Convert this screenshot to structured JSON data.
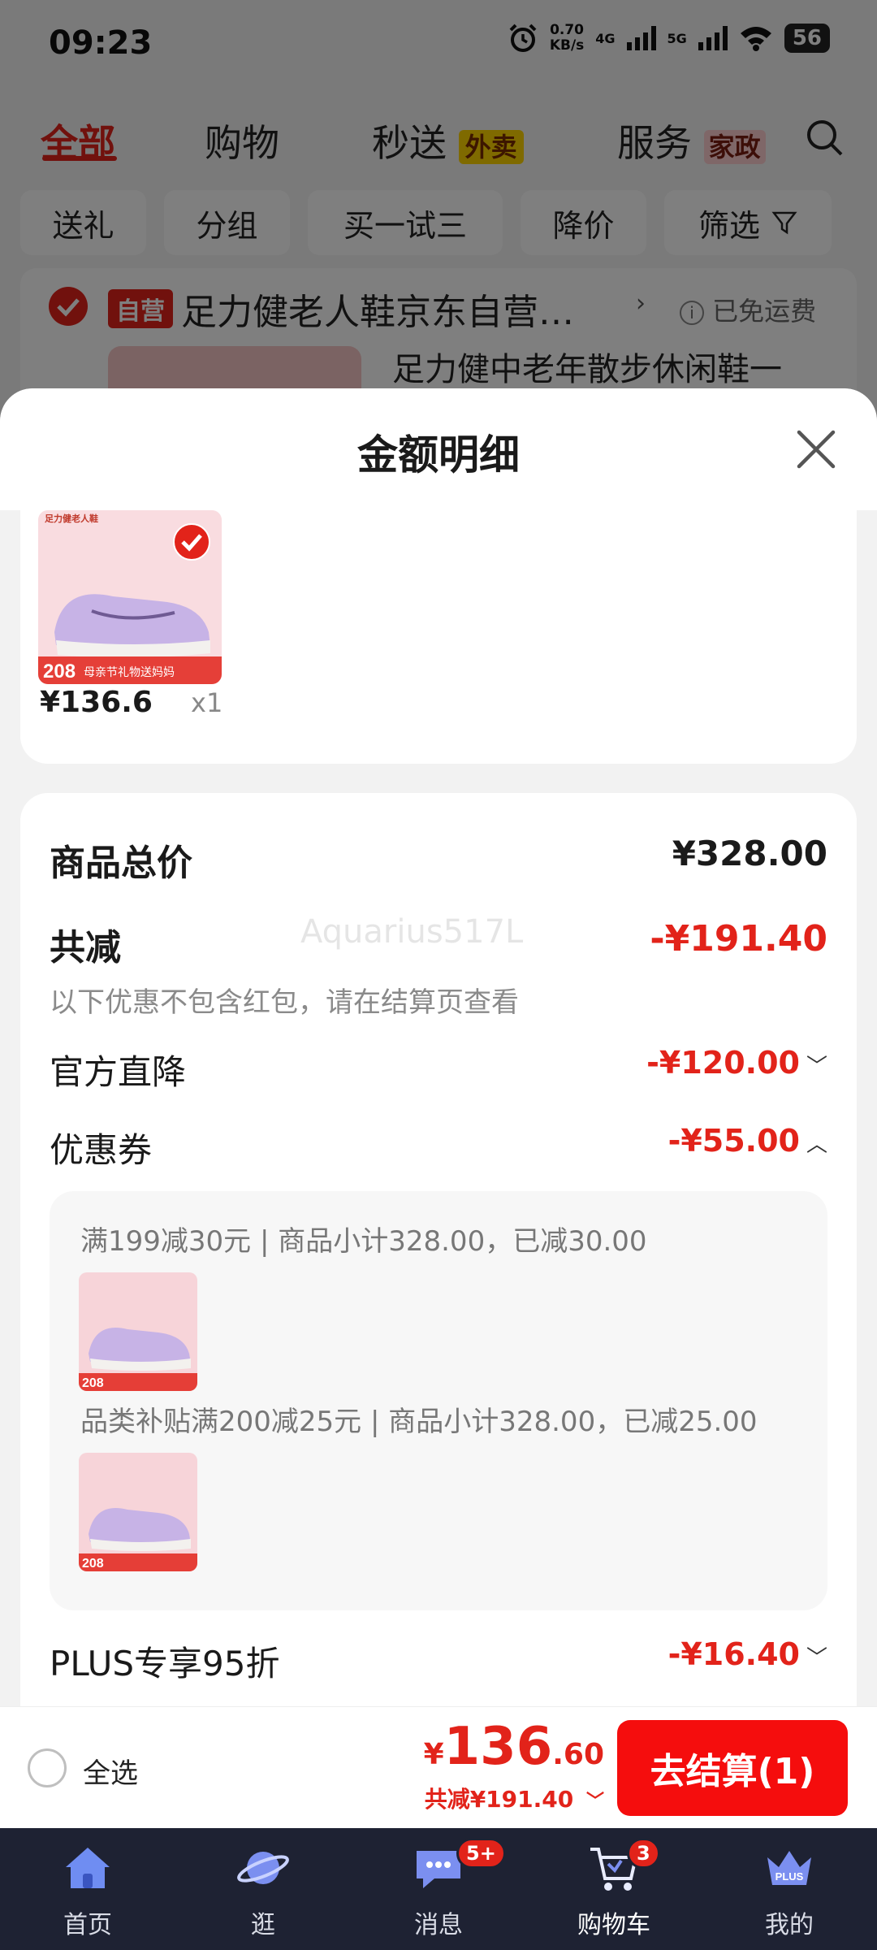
{
  "status_bar": {
    "time": "09:23",
    "net_speed": "0.70",
    "net_unit": "KB/s",
    "net_4g": "4G",
    "net_5g": "5G",
    "battery": "56"
  },
  "top_tabs": {
    "all": "全部",
    "shopping": "购物",
    "instant": "秒送",
    "instant_badge": "外卖",
    "service": "服务",
    "service_badge": "家政"
  },
  "filter_chips": {
    "gift": "送礼",
    "group": "分组",
    "try": "买一试三",
    "price_drop": "降价",
    "filter": "筛选"
  },
  "store": {
    "badge": "自营",
    "name": "足力健老人鞋京东自营…",
    "shipping": "已免运费",
    "product_title": "足力健中老年散步休闲鞋一"
  },
  "sheet": {
    "title": "金额明细",
    "item": {
      "price": "¥136.6",
      "qty": "x1",
      "brand": "足力健老人鞋",
      "promo_num": "208",
      "promo_text": "母亲节礼物送妈妈"
    }
  },
  "detail": {
    "total_label": "商品总价",
    "total_value": "¥328.00",
    "reduce_label": "共减",
    "reduce_value": "-¥191.40",
    "note": "以下优惠不包含红包，请在结算页查看",
    "official_label": "官方直降",
    "official_value": "-¥120.00",
    "coupon_label": "优惠券",
    "coupon_value": "-¥55.00",
    "coupon_line1": "满199减30元 | 商品小计328.00，已减30.00",
    "coupon_line2": "品类补贴满200减25元 | 商品小计328.00，已减25.00",
    "plus_label": "PLUS专享95折",
    "plus_value": "-¥16.40",
    "watermark": "Aquarius517L"
  },
  "checkout": {
    "select_all": "全选",
    "currency": "¥",
    "total_int": "136",
    "total_dec": ".60",
    "saved": "共减¥191.40",
    "button": "去结算(1)"
  },
  "tabbar": {
    "home": "首页",
    "browse": "逛",
    "messages": "消息",
    "messages_badge": "5+",
    "cart": "购物车",
    "cart_badge": "3",
    "mine": "我的",
    "plus_text": "PLUS"
  },
  "colors": {
    "accent_red": "#e2231a",
    "button_red": "#f50d0d",
    "tabbar_bg": "#1e2233"
  },
  "icons": [
    "alarm-icon",
    "signal-icon",
    "wifi-icon",
    "search-icon",
    "filter-icon",
    "check-icon",
    "close-icon",
    "chevron-down-icon",
    "chevron-up-icon",
    "home-icon",
    "planet-icon",
    "chat-icon",
    "cart-icon",
    "plus-crown-icon"
  ]
}
